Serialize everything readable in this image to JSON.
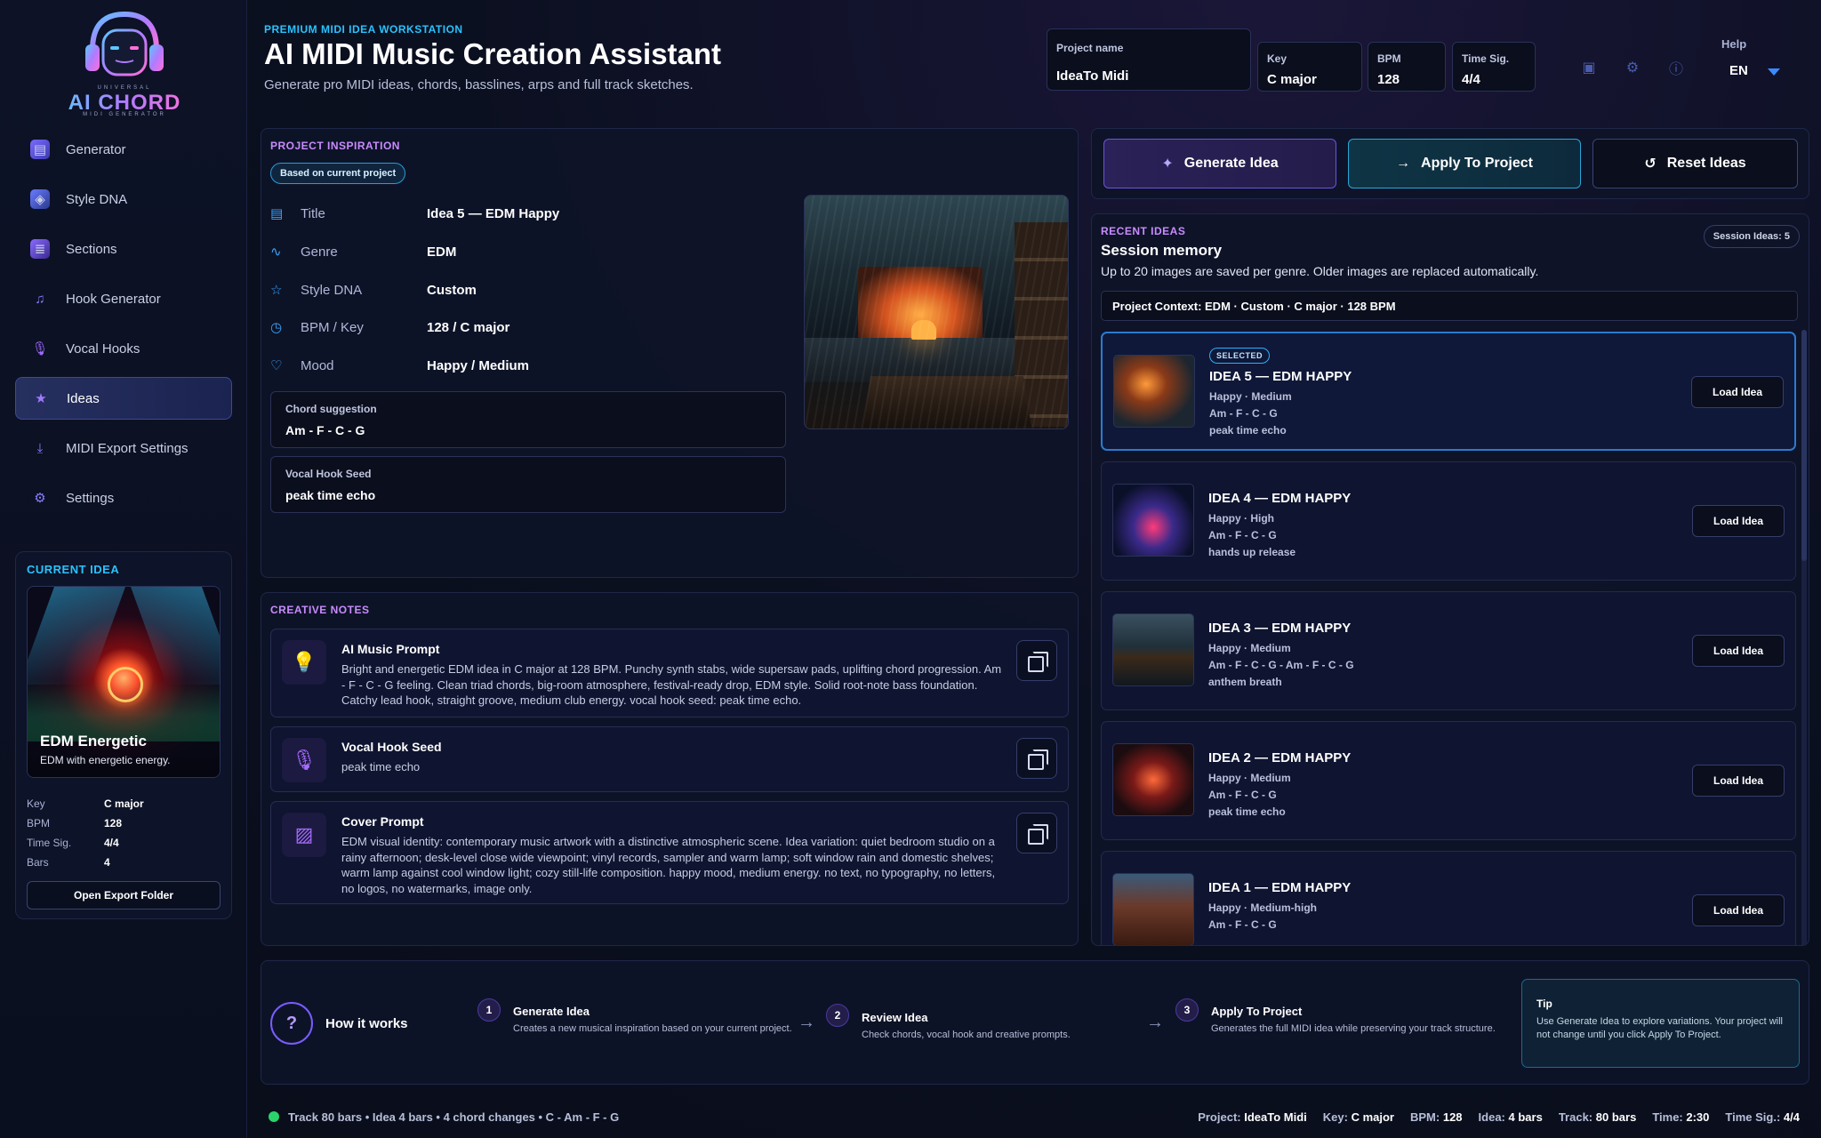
{
  "brand": {
    "line1": "UNIVERSAL",
    "line2": "AI CHORD",
    "line3": "MIDI GENERATOR"
  },
  "sidebar": {
    "items": [
      {
        "label": "Generator",
        "icon": "generator-icon",
        "active": false
      },
      {
        "label": "Style DNA",
        "icon": "cube-icon",
        "active": false
      },
      {
        "label": "Sections",
        "icon": "layers-icon",
        "active": false
      },
      {
        "label": "Hook Generator",
        "icon": "music-note-icon",
        "active": false
      },
      {
        "label": "Vocal Hooks",
        "icon": "microphone-icon",
        "active": false
      },
      {
        "label": "Ideas",
        "icon": "star-icon",
        "active": true
      },
      {
        "label": "MIDI Export Settings",
        "icon": "download-icon",
        "active": false
      },
      {
        "label": "Settings",
        "icon": "gear-icon",
        "active": false
      }
    ]
  },
  "current_idea": {
    "heading": "CURRENT IDEA",
    "name": "EDM Energetic",
    "description": "EDM with energetic energy.",
    "props": [
      {
        "k": "Key",
        "v": "C major"
      },
      {
        "k": "BPM",
        "v": "128"
      },
      {
        "k": "Time Sig.",
        "v": "4/4"
      },
      {
        "k": "Bars",
        "v": "4"
      }
    ],
    "export_button": "Open Export Folder"
  },
  "header": {
    "kicker": "PREMIUM MIDI IDEA WORKSTATION",
    "title": "AI MIDI Music Creation Assistant",
    "subtitle": "Generate pro MIDI ideas, chords, basslines, arps and full track sketches.",
    "project_name_label": "Project name",
    "project_name": "IdeaTo Midi",
    "key_label": "Key",
    "key": "C major",
    "bpm_label": "BPM",
    "bpm": "128",
    "timesig_label": "Time Sig.",
    "timesig": "4/4",
    "help_label": "Help",
    "language": "EN"
  },
  "inspiration": {
    "heading": "PROJECT INSPIRATION",
    "badge": "Based on current project",
    "rows": [
      {
        "icon": "document-icon",
        "k": "Title",
        "v": "Idea 5 — EDM Happy"
      },
      {
        "icon": "wave-icon",
        "k": "Genre",
        "v": "EDM"
      },
      {
        "icon": "star-outline-icon",
        "k": "Style DNA",
        "v": "Custom"
      },
      {
        "icon": "clock-icon",
        "k": "BPM / Key",
        "v": "128 / C major"
      },
      {
        "icon": "heart-icon",
        "k": "Mood",
        "v": "Happy / Medium"
      }
    ],
    "chord_label": "Chord suggestion",
    "chord_value": "Am - F - C - G",
    "vocal_label": "Vocal Hook Seed",
    "vocal_value": "peak time echo"
  },
  "notes": {
    "heading": "CREATIVE NOTES",
    "items": [
      {
        "icon": "lightbulb-icon",
        "title": "AI Music Prompt",
        "body": "Bright and energetic EDM idea in C major at 128 BPM. Punchy synth stabs, wide supersaw pads, uplifting chord progression. Am - F - C - G feeling. Clean triad chords, big-room atmosphere, festival-ready drop, EDM style. Solid root-note bass foundation. Catchy lead hook, straight groove, medium club energy. vocal hook seed: peak time echo."
      },
      {
        "icon": "microphone-icon",
        "title": "Vocal Hook Seed",
        "body": "peak time echo"
      },
      {
        "icon": "image-icon",
        "title": "Cover Prompt",
        "body": "EDM visual identity: contemporary music artwork with a distinctive atmospheric scene. Idea variation: quiet bedroom studio on a rainy afternoon; desk-level close wide viewpoint; vinyl records, sampler and warm lamp; soft window rain and domestic shelves; warm lamp against cool window light; cozy still-life composition. happy mood, medium energy. no text, no typography, no letters, no logos, no watermarks, image only."
      }
    ]
  },
  "actions": {
    "generate": "Generate Idea",
    "apply": "Apply To Project",
    "reset": "Reset Ideas"
  },
  "recent": {
    "heading": "RECENT IDEAS",
    "session_badge": "Session Ideas: 5",
    "title": "Session memory",
    "subtitle": "Up to 20 images are saved per genre. Older images are replaced automatically.",
    "context": "Project Context: EDM · Custom · C major · 128 BPM",
    "selected_badge": "SELECTED",
    "load_label": "Load Idea",
    "ideas": [
      {
        "title": "IDEA 5 — EDM HAPPY",
        "mood": "Happy · Medium",
        "chords": "Am - F - C - G",
        "hook": "peak time echo",
        "selected": true
      },
      {
        "title": "IDEA 4 — EDM HAPPY",
        "mood": "Happy · High",
        "chords": "Am - F - C - G",
        "hook": "hands up release",
        "selected": false
      },
      {
        "title": "IDEA 3 — EDM HAPPY",
        "mood": "Happy · Medium",
        "chords": "Am - F - C - G - Am - F - C - G",
        "hook": "anthem breath",
        "selected": false
      },
      {
        "title": "IDEA 2 — EDM HAPPY",
        "mood": "Happy · Medium",
        "chords": "Am - F - C - G",
        "hook": "peak time echo",
        "selected": false
      },
      {
        "title": "IDEA 1 — EDM HAPPY",
        "mood": "Happy · Medium-high",
        "chords": "Am - F - C - G",
        "hook": "",
        "selected": false
      }
    ]
  },
  "how": {
    "title": "How it works",
    "steps": [
      {
        "n": "1",
        "title": "Generate Idea",
        "desc": "Creates a new musical inspiration based on your current project."
      },
      {
        "n": "2",
        "title": "Review Idea",
        "desc": "Check chords, vocal hook and creative prompts."
      },
      {
        "n": "3",
        "title": "Apply To Project",
        "desc": "Generates the full MIDI idea while preserving your track structure."
      }
    ],
    "tip_title": "Tip",
    "tip_body": "Use Generate Idea to explore variations. Your project will not change until you click Apply To Project."
  },
  "status": {
    "left": "Track 80 bars • Idea 4 bars • 4 chord changes • C - Am - F - G",
    "project_label": "Project:",
    "project": "IdeaTo Midi",
    "key_label": "Key:",
    "key": "C major",
    "bpm_label": "BPM:",
    "bpm": "128",
    "idea_label": "Idea:",
    "idea": "4 bars",
    "track_label": "Track:",
    "track": "80 bars",
    "time_label": "Time:",
    "time": "2:30",
    "timesig_label": "Time Sig.:",
    "timesig": "4/4"
  }
}
